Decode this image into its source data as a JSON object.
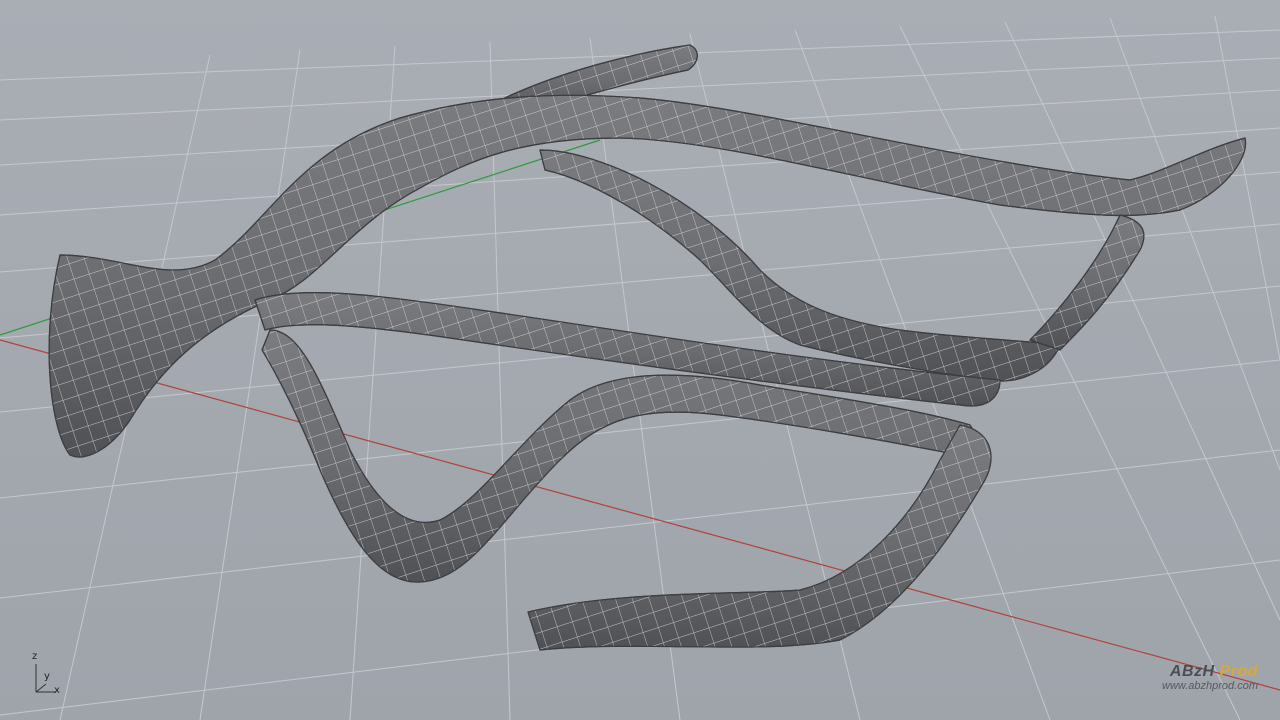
{
  "viewport": {
    "background_color": "#a5aab1",
    "grid_color": "#c4c8ce",
    "x_axis_color": "#b0423a",
    "y_axis_color": "#2e9a3c",
    "model_color": "#6f7073",
    "wire_color": "#d9dadc"
  },
  "axes_gizmo": {
    "z_label": "z",
    "y_label": "y",
    "x_label": "x"
  },
  "watermark": {
    "brand_part1": "ABzH",
    "brand_part2": "Prod",
    "url": "www.abzhprod.com",
    "brand_accent_color": "#d6a93a"
  }
}
